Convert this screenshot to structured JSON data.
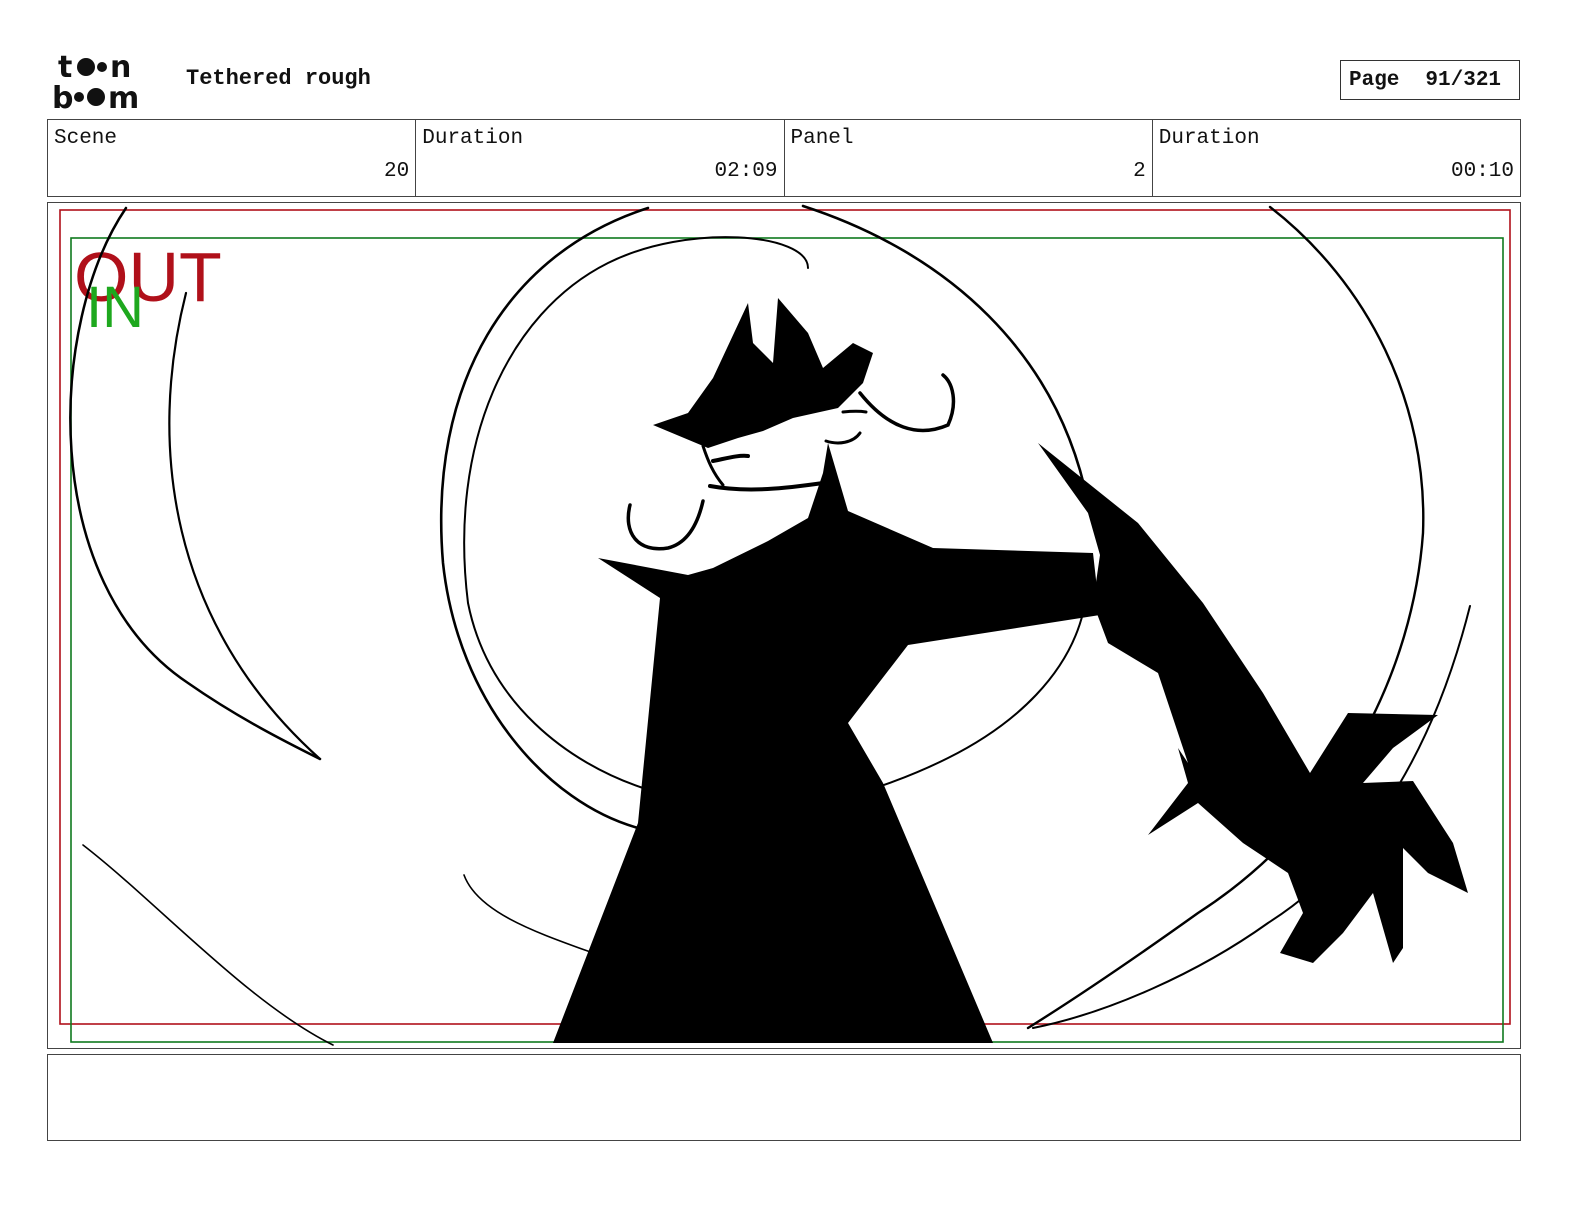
{
  "header": {
    "logo_text_line1": "toon",
    "logo_text_line2": "boom",
    "title": "Tethered rough",
    "page_label": "Page",
    "page_value": "91/321"
  },
  "info": [
    {
      "label": "Scene",
      "value": "20"
    },
    {
      "label": "Duration",
      "value": "02:09"
    },
    {
      "label": "Panel",
      "value": "2"
    },
    {
      "label": "Duration",
      "value": "00:10"
    }
  ],
  "panel": {
    "out_label": "OUT",
    "in_label": "IN",
    "colors": {
      "out_frame": "#b0101a",
      "in_frame": "#0f7a1e",
      "in_text": "#1ea81e",
      "ink": "#000000"
    }
  },
  "notes": {
    "text": ""
  }
}
